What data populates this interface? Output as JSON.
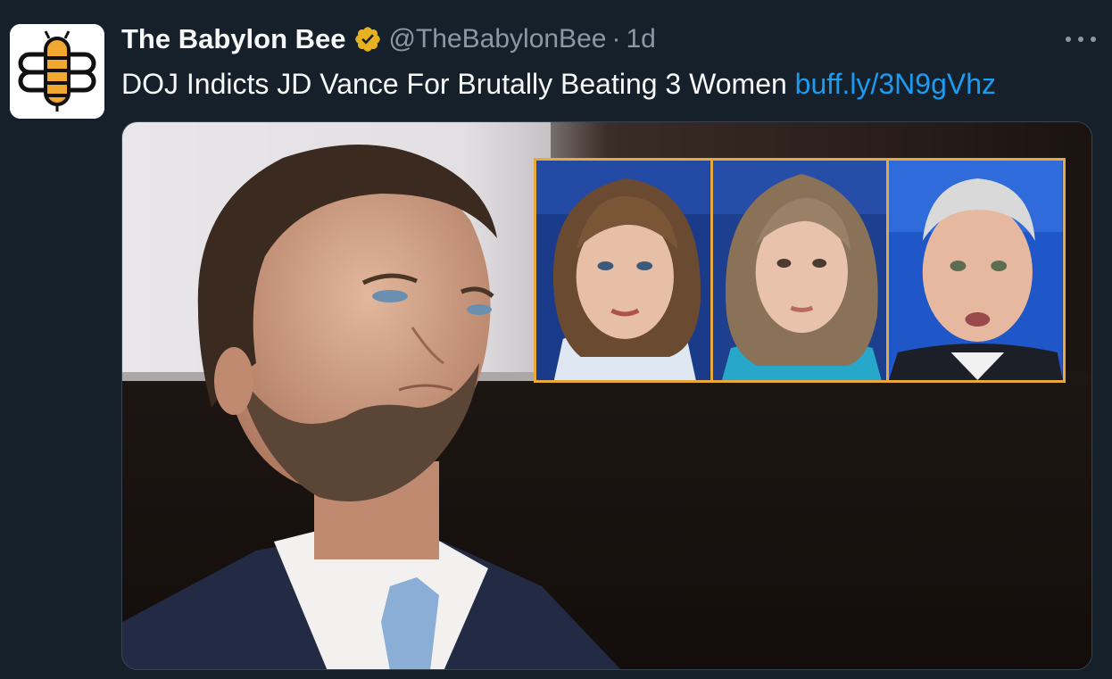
{
  "tweet": {
    "display_name": "The Babylon Bee",
    "handle": "@TheBabylonBee",
    "separator": "·",
    "time": "1d",
    "text": "DOJ Indicts JD Vance For Brutally Beating 3 Women ",
    "link": "buff.ly/3N9gVhz"
  },
  "icons": {
    "avatar": "bee-logo",
    "verified": "verified-badge-icon",
    "more": "more-options-icon"
  },
  "colors": {
    "background": "#15202b",
    "primary_text": "#f7f9f9",
    "secondary_text": "#8b98a5",
    "link": "#1d9bf0",
    "verified_gold": "#e8b11f",
    "inset_border": "#e8a93c"
  }
}
